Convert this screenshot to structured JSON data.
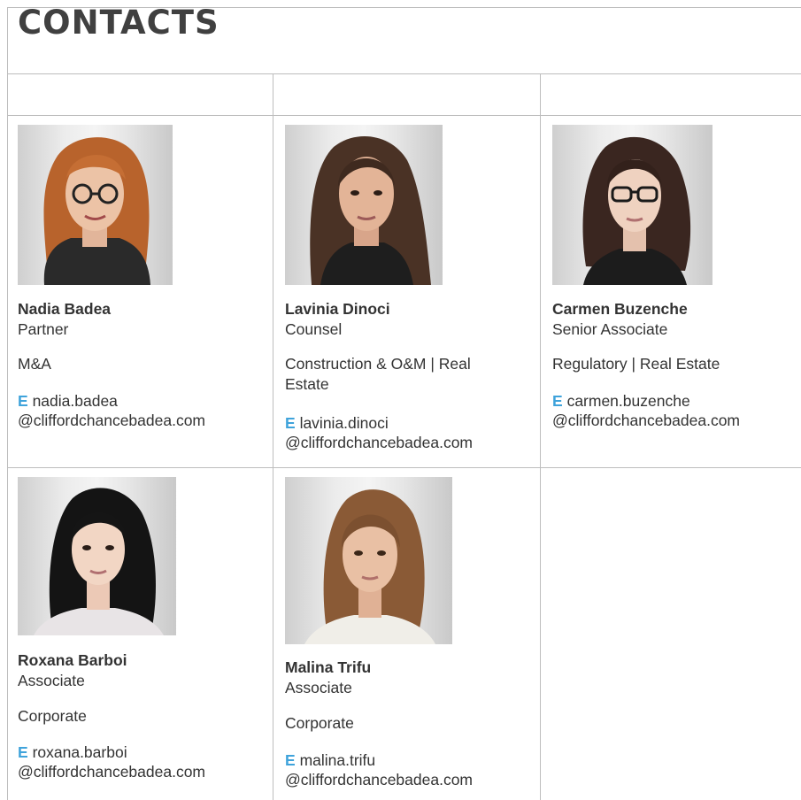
{
  "page": {
    "title": "CONTACTS"
  },
  "contacts": [
    {
      "name": "Nadia Badea",
      "role": "Partner",
      "practice": "M&A",
      "email_label": "E",
      "email_user": "nadia.badea",
      "email_domain": "@cliffordchancebadea.com",
      "photo": "portrait-woman-glasses-auburn-hair"
    },
    {
      "name": "Lavinia Dinoci",
      "role": "Counsel",
      "practice_line1": "Construction & O&M | Real",
      "practice_line2": "Estate",
      "email_label": "E",
      "email_user": "lavinia.dinoci",
      "email_domain": "@cliffordchancebadea.com",
      "photo": "portrait-woman-dark-wavy-hair"
    },
    {
      "name": "Carmen Buzenche",
      "role": "Senior Associate",
      "practice": "Regulatory | Real Estate",
      "email_label": "E",
      "email_user": "carmen.buzenche",
      "email_domain": "@cliffordchancebadea.com",
      "photo": "portrait-woman-glasses-dark-hair"
    },
    {
      "name": "Roxana Barboi",
      "role": "Associate",
      "practice": "Corporate",
      "email_label": "E",
      "email_user": "roxana.barboi",
      "email_domain": "@cliffordchancebadea.com",
      "photo": "portrait-woman-long-black-hair"
    },
    {
      "name": "Malina Trifu",
      "role": "Associate",
      "practice": "Corporate",
      "email_label": "E",
      "email_user": "malina.trifu",
      "email_domain": "@cliffordchancebadea.com",
      "photo": "portrait-woman-light-brown-hair"
    }
  ]
}
